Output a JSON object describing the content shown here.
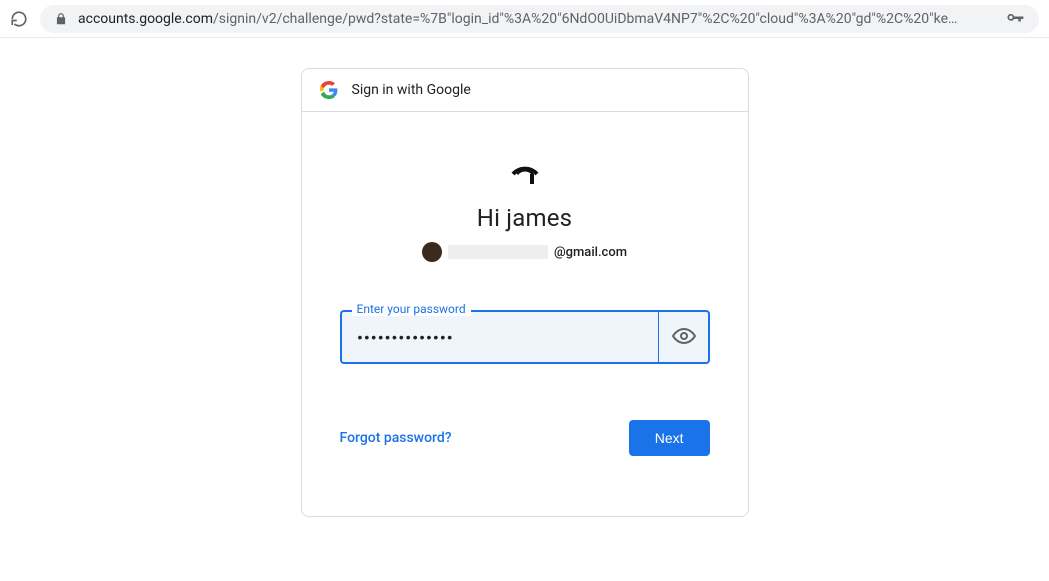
{
  "browser": {
    "url_domain": "accounts.google.com",
    "url_path": "/signin/v2/challenge/pwd?state=%7B\"login_id\"%3A%20\"6NdO0UiDbmaV4NP7\"%2C%20\"cloud\"%3A%20\"gd\"%2C%20\"ke…"
  },
  "card": {
    "header_text": "Sign in with Google",
    "heading": "Hi james",
    "email_suffix": "@gmail.com",
    "password_label": "Enter your password",
    "password_value": "••••••••••••••",
    "forgot": "Forgot password?",
    "next": "Next"
  }
}
